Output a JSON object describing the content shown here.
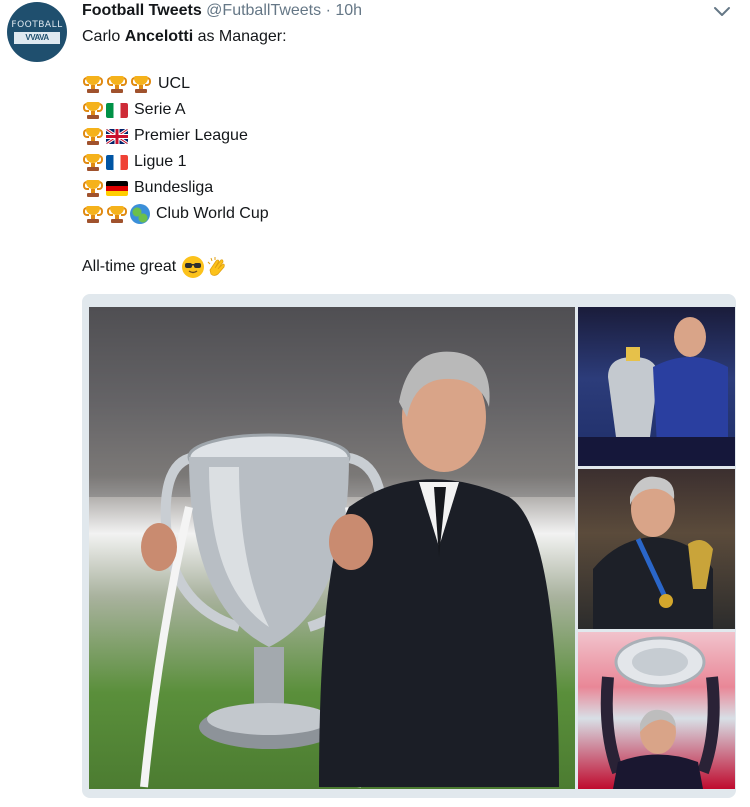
{
  "tweet": {
    "author_name": "Football Tweets",
    "handle": "@FutballTweets",
    "separator": "·",
    "time": "10h",
    "avatar_text_top": "FOOTBALL",
    "avatar_text_bottom": "VVAVA",
    "intro_prefix": "Carlo ",
    "intro_bold": "Ancelotti",
    "intro_suffix": " as Manager:",
    "honours": [
      {
        "label": "UCL",
        "trophies": 3,
        "icon": "none"
      },
      {
        "label": "Serie A",
        "trophies": 1,
        "icon": "italy-flag"
      },
      {
        "label": "Premier League",
        "trophies": 1,
        "icon": "uk-flag"
      },
      {
        "label": "Ligue 1",
        "trophies": 1,
        "icon": "france-flag"
      },
      {
        "label": "Bundesliga",
        "trophies": 1,
        "icon": "germany-flag"
      },
      {
        "label": "Club World Cup",
        "trophies": 2,
        "icon": "globe"
      }
    ],
    "closing": "All-time great",
    "closing_emojis": [
      "sunglasses-emoji",
      "clapping-hands-emoji"
    ]
  },
  "colors": {
    "text": "#14171a",
    "muted": "#657786",
    "border": "#e1e8ed",
    "avatar_bg": "#1f4f6e"
  },
  "media": {
    "photos": [
      "main-trophy-photo",
      "premier-league-celebration-photo",
      "medal-photo",
      "bundesliga-shield-photo"
    ]
  }
}
